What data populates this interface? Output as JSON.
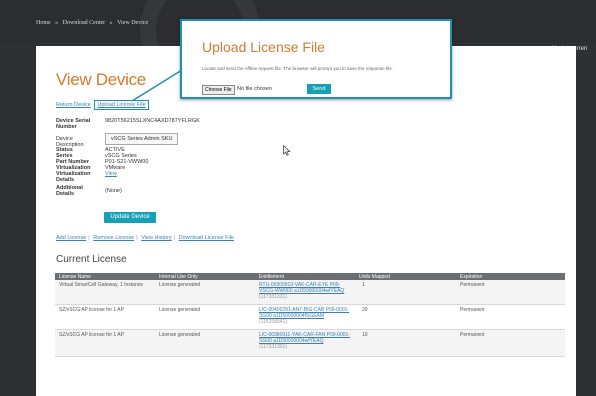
{
  "breadcrumb": [
    "Home",
    "»",
    "Download Center",
    "»",
    "View Device"
  ],
  "welcome": "You're curren",
  "page_title": "View Device",
  "top_links": {
    "return_device": "Return Device",
    "upload_license": "Upload License File"
  },
  "fields": {
    "serial_label": "Device Serial Number",
    "serial_value": "9820T56215SLXNC4AXD787YFLRGK",
    "description_label": "Device Description",
    "description_value": "vSCG Series Admin SKU",
    "status_label": "Status",
    "status_value": "ACTIVE",
    "series_label": "Series",
    "series_value": "vSCG Series",
    "part_label": "Part Number",
    "part_value": "P01-S21-VWW00",
    "virtualization_label": "Virtualization",
    "virtualization_value": "VMware",
    "virt_details_label": "Virtualization Details",
    "virt_details_value": "View",
    "additional_label": "Additional Details",
    "additional_value": "(None)"
  },
  "update_button": "Update Device",
  "actions": [
    "Add License",
    "Remove License",
    "View History",
    "Download License File"
  ],
  "current_license_title": "Current License",
  "table": {
    "headers": [
      "License Name",
      "Internal Use Only",
      "Entitlement",
      "Units Mapped",
      "Expiration"
    ],
    "rows": [
      {
        "name": "Virtual SmartCell Gateway, 1 Instance",
        "internal": "License generated",
        "ent1": "RTU-00309910-VAK-CAR-EYE P09-",
        "ent2": "VSCG-WW000 a1D50000004wfYEAQ",
        "ent3": "(117331331)",
        "units": "1",
        "exp": "Permanent"
      },
      {
        "name": "SZ/vSCG AP license for 1 AP",
        "internal": "License generated",
        "ent1": "LIC-00400291-ANT-BIG-CAB P09-0001-",
        "ent2": "SG00 a1D50000004fSGEAM",
        "ent3": "(116258541)",
        "units": "20",
        "exp": "Permanent"
      },
      {
        "name": "SZ/vSCG AP license for 1 AP",
        "internal": "License generated",
        "ent1": "LIC-00380911-YAK-CAR-FAN P09-0001-",
        "ent2": "SG00 a1D50000004wfYEAQ",
        "ent3": "(117331301)",
        "units": "10",
        "exp": "Permanent"
      }
    ]
  },
  "popup": {
    "title": "Upload License File",
    "description": "Locate and send the offline request file. The browser will prompt you to save the response file.",
    "choose_file": "Choose File",
    "no_file": "No file chosen",
    "send": "Send"
  },
  "colors": {
    "accent_orange": "#d27a2f",
    "teal": "#17a0b5",
    "callout_border": "#1e8fb8",
    "link_blue": "#3a80b8"
  }
}
